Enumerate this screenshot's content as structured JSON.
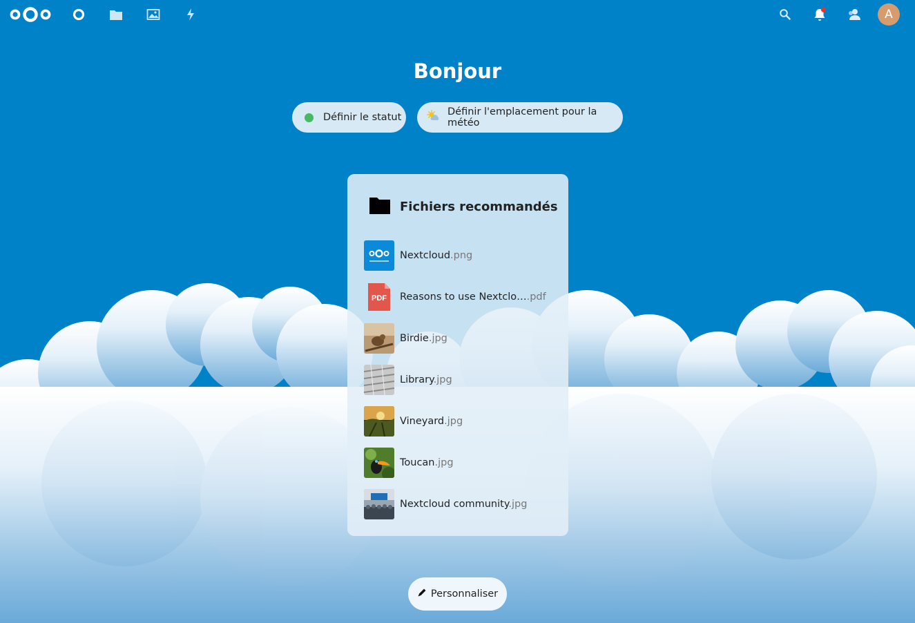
{
  "header": {
    "apps": [
      "dashboard-icon",
      "files-icon",
      "photos-icon",
      "activity-icon"
    ],
    "right_icons": [
      "search-icon",
      "notifications-icon",
      "contacts-icon"
    ],
    "avatar_initial": "A",
    "notification_badge_color": "#e9322d"
  },
  "greeting": "Bonjour",
  "status_button": {
    "label": "Définir le statut",
    "dot_color": "#46ba61"
  },
  "weather_button": {
    "label": "Définir l'emplacement pour la météo"
  },
  "widget": {
    "title": "Fichiers recommandés",
    "files": [
      {
        "name": "Nextcloud",
        "ext": ".png",
        "thumb": "nextcloud-logo"
      },
      {
        "name": "Reasons to use Nextclo…",
        "ext": ".pdf",
        "thumb": "pdf-icon"
      },
      {
        "name": "Birdie",
        "ext": ".jpg",
        "thumb": "birdie-photo"
      },
      {
        "name": "Library",
        "ext": ".jpg",
        "thumb": "library-photo"
      },
      {
        "name": "Vineyard",
        "ext": ".jpg",
        "thumb": "vineyard-photo"
      },
      {
        "name": "Toucan",
        "ext": ".jpg",
        "thumb": "toucan-photo"
      },
      {
        "name": "Nextcloud community",
        "ext": ".jpg",
        "thumb": "community-photo"
      }
    ]
  },
  "customize_button": {
    "label": "Personnaliser"
  },
  "colors": {
    "primary": "#0082c9",
    "avatar": "#d69c6d",
    "pdf": "#e2574c"
  }
}
